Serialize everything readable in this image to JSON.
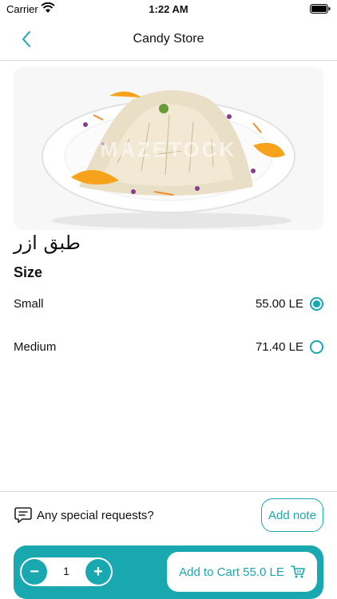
{
  "status": {
    "carrier": "Carrier",
    "time": "1:22 AM"
  },
  "nav": {
    "title": "Candy Store"
  },
  "hero": {
    "watermark": "MAZETOCK"
  },
  "product": {
    "name": "طبق ازر"
  },
  "size": {
    "heading": "Size",
    "options": [
      {
        "label": "Small",
        "price": "55.00 LE",
        "selected": true
      },
      {
        "label": "Medium",
        "price": "71.40 LE",
        "selected": false
      }
    ]
  },
  "special": {
    "label": "Any special requests?",
    "button": "Add note"
  },
  "cart": {
    "quantity": "1",
    "minus": "−",
    "plus": "+",
    "add_label": "Add to Cart 55.0 LE"
  },
  "colors": {
    "accent": "#19a8b0"
  },
  "icons": {
    "back": "chevron-left-icon",
    "note": "chat-note-icon",
    "cart": "cart-icon"
  }
}
